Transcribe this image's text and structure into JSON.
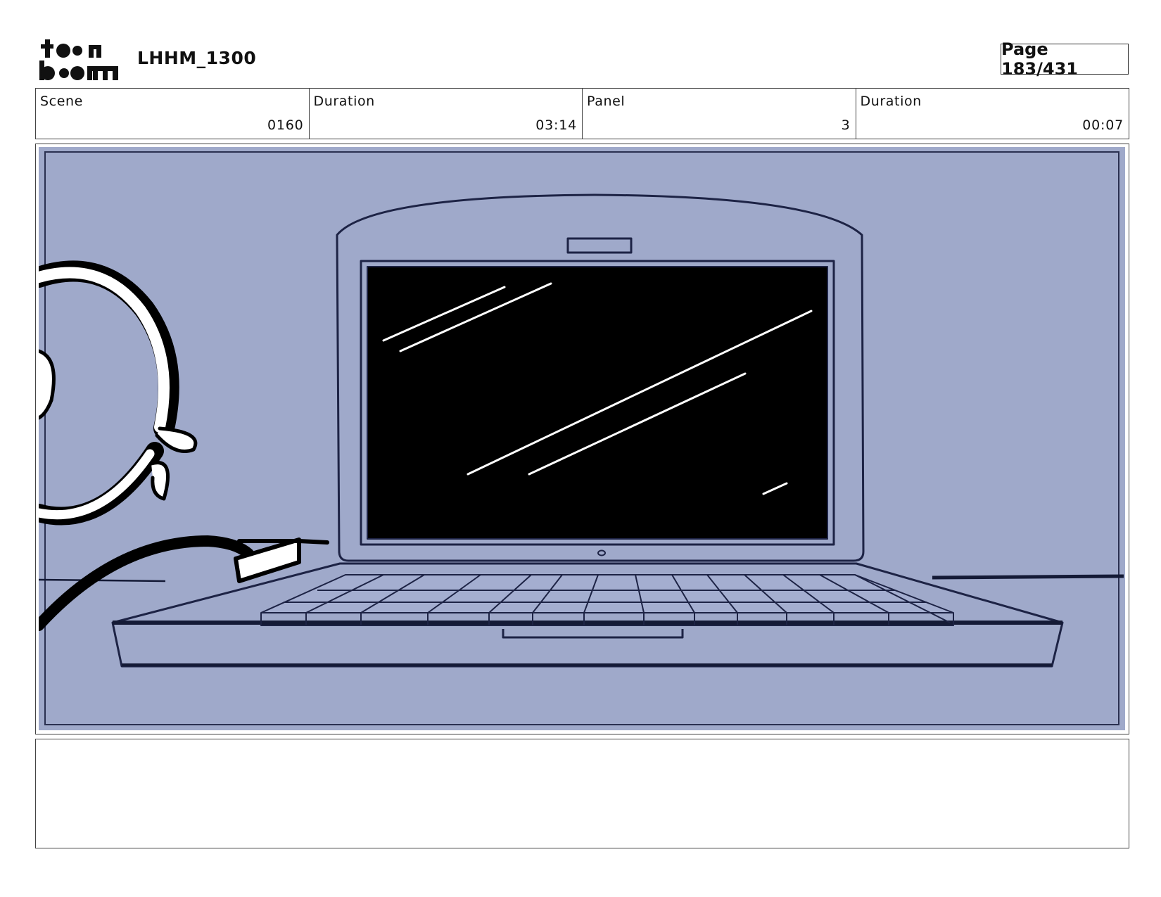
{
  "header": {
    "logo_text": "toon boom",
    "project_title": "LHHM_1300",
    "page_label": "Page 183/431"
  },
  "info": {
    "scene_label": "Scene",
    "scene_value": "0160",
    "scene_duration_label": "Duration",
    "scene_duration_value": "03:14",
    "panel_label": "Panel",
    "panel_value": "3",
    "panel_duration_label": "Duration",
    "panel_duration_value": "00:07"
  },
  "colors": {
    "panel_background": "#9fa9ca",
    "line_ink": "#1d2345",
    "screen": "#000000"
  },
  "notes": {
    "text": ""
  }
}
